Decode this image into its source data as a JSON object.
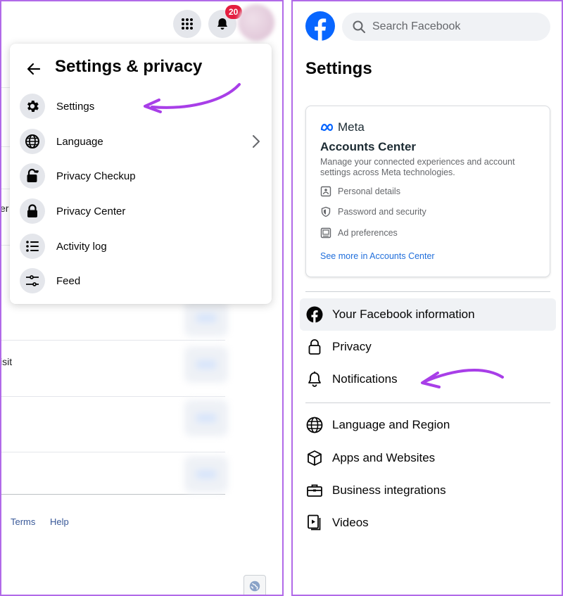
{
  "left_panel": {
    "notification_count": "20",
    "menu": {
      "title": "Settings & privacy",
      "items": [
        {
          "label": "Settings",
          "icon": "gear-icon"
        },
        {
          "label": "Language",
          "icon": "globe-icon",
          "has_submenu": true
        },
        {
          "label": "Privacy Checkup",
          "icon": "lock-heart-icon"
        },
        {
          "label": "Privacy Center",
          "icon": "lock-icon"
        },
        {
          "label": "Activity log",
          "icon": "list-icon"
        },
        {
          "label": "Feed",
          "icon": "sliders-icon"
        }
      ]
    },
    "background": {
      "partial_text_1": "er",
      "partial_text_2": "isit"
    },
    "footer_links": [
      "Terms",
      "Help"
    ]
  },
  "right_panel": {
    "search_placeholder": "Search Facebook",
    "page_title": "Settings",
    "accounts_center": {
      "brand": "Meta",
      "title": "Accounts Center",
      "description": "Manage your connected experiences and account settings across Meta technologies.",
      "rows": [
        {
          "label": "Personal details",
          "icon": "id-card-icon"
        },
        {
          "label": "Password and security",
          "icon": "shield-icon"
        },
        {
          "label": "Ad preferences",
          "icon": "monitor-icon"
        }
      ],
      "link": "See more in Accounts Center"
    },
    "section1": [
      {
        "label": "Your Facebook information",
        "icon": "facebook-icon"
      },
      {
        "label": "Privacy",
        "icon": "lock-icon"
      },
      {
        "label": "Notifications",
        "icon": "bell-icon"
      }
    ],
    "section2": [
      {
        "label": "Language and Region",
        "icon": "globe-icon"
      },
      {
        "label": "Apps and Websites",
        "icon": "cube-icon"
      },
      {
        "label": "Business integrations",
        "icon": "briefcase-icon"
      },
      {
        "label": "Videos",
        "icon": "video-icon"
      }
    ]
  },
  "colors": {
    "frame_border": "#b16ae8",
    "annotation_arrow": "#a83ee8",
    "facebook_blue": "#0866ff",
    "link_blue": "#216fdb",
    "badge_red": "#e41e3f"
  }
}
